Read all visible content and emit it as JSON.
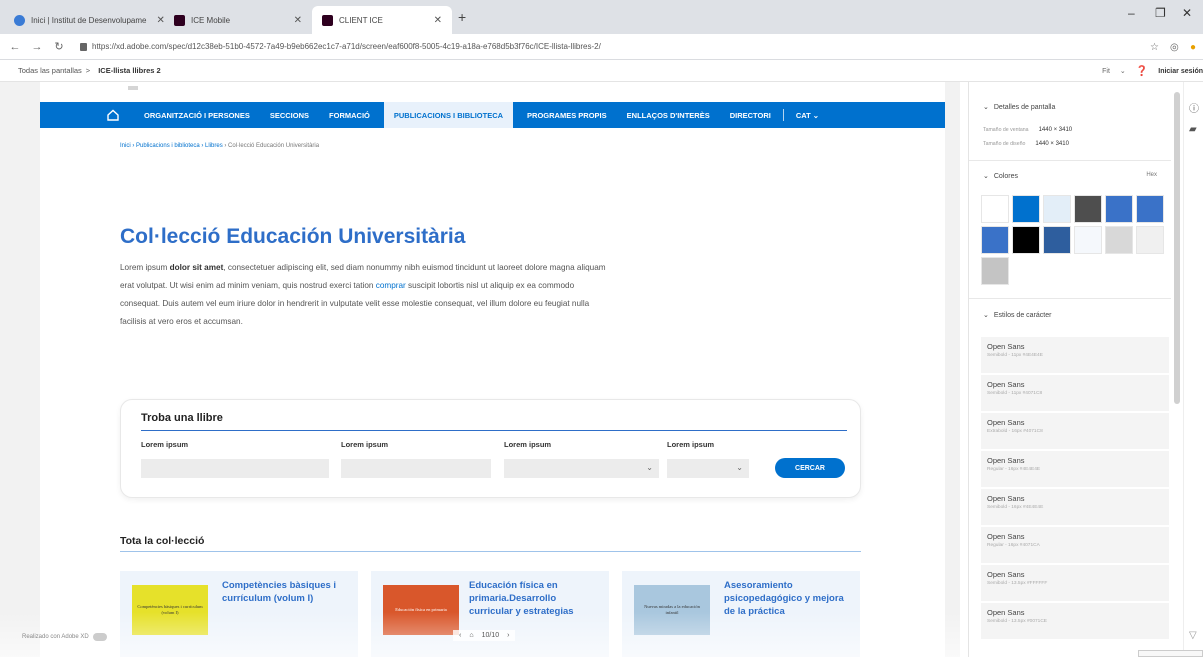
{
  "browser": {
    "tabs": [
      {
        "title": "Inici | Institut de Desenvolupame"
      },
      {
        "title": "ICE Mobile"
      },
      {
        "title": "CLIENT ICE"
      }
    ],
    "url": "https://xd.adobe.com/spec/d12c38eb-51b0-4572-7a49-b9eb662ec1c7-a71d/screen/eaf600f8-5005-4c19-a18a-e768d5b3f76c/ICE-llista-llibres-2/"
  },
  "xd": {
    "breadcrumb_root": "Todas las pantallas",
    "breadcrumb_sep": ">",
    "breadcrumb_current": "ICE-llista llibres 2",
    "zoom": "Fit",
    "signin": "Iniciar sesión",
    "made_with": "Realizado con Adobe XD",
    "pager": "10/10"
  },
  "site": {
    "menu": [
      "ORGANITZACIÓ I PERSONES",
      "SECCIONS",
      "FORMACIÓ",
      "PUBLICACIONS I BIBLIOTECA",
      "PROGRAMES PROPIS",
      "ENLLAÇOS D'INTERÈS",
      "DIRECTORI"
    ],
    "lang": "CAT",
    "crumb_link": "Inici › Publicacions i biblioteca › Llibres",
    "crumb_current": " › Col·lecció Educación Universitària",
    "title": "Col·lecció Educación Universitària",
    "para_a": "Lorem ipsum ",
    "para_b": "dolor sit amet",
    "para_c": ", consectetuer adipiscing elit, sed diam nonummy nibh euismod tincidunt ut laoreet dolore magna aliquam erat volutpat. Ut wisi enim ad minim veniam, quis nostrud exerci tation ",
    "para_link": "comprar",
    "para_d": " suscipit lobortis nisl ut aliquip ex ea commodo consequat. Duis autem vel eum iriure dolor in hendrerit in vulputate velit esse molestie consequat, vel illum dolore eu feugiat nulla facilisis at vero eros et accumsan.",
    "search_title": "Troba una llibre",
    "field_labels": [
      "Lorem ipsum",
      "Lorem ipsum",
      "Lorem ipsum",
      "Lorem ipsum"
    ],
    "search_button": "CERCAR",
    "collection_title": "Tota la col·lecció",
    "cards": [
      {
        "title": "Competències bàsiques i currículum (volum I)",
        "cover_text": "Competències bàsiques i currículum (volum I)",
        "cover_color": "#e6e12a"
      },
      {
        "title": "Educación física en primaria.Desarrollo curricular y estrategias",
        "cover_text": "Educación física en primaria",
        "cover_color": "#d9572b"
      },
      {
        "title": "Asesoramiento psicopedagógico y mejora de la práctica",
        "cover_text": "Nuevas miradas a la educación infantil",
        "cover_color": "#a9c7de"
      }
    ]
  },
  "panel": {
    "screen_details": "Detalles de pantalla",
    "window_size_label": "Tamaño de ventana",
    "window_size": "1440 × 3410",
    "design_size_label": "Tamaño de diseño",
    "design_size": "1440 × 3410",
    "colors_title": "Colores",
    "hex_label": "Hex",
    "colors": [
      "#FFFFFF",
      "#0071CE",
      "#E3EEF8",
      "#4E4E4E",
      "#3A72C8",
      "#3A72C8",
      "#3A72C8",
      "#000000",
      "#2E5E9E",
      "#F5F8FC",
      "#D8D8D8",
      "#F0F0F0",
      "#C4C4C4"
    ],
    "char_styles_title": "Estilos de carácter",
    "char_styles": [
      {
        "name": "Open Sans",
        "desc": "Semibold - 11px #4E4E4E"
      },
      {
        "name": "Open Sans",
        "desc": "Semibold - 11px #4071C8"
      },
      {
        "name": "Open Sans",
        "desc": "Extrabold - 16px #4071C8"
      },
      {
        "name": "Open Sans",
        "desc": "Regular - 16px #4E4E4E"
      },
      {
        "name": "Open Sans",
        "desc": "Semibold - 16px #4E4E4E"
      },
      {
        "name": "Open Sans",
        "desc": "Regular - 16px #4071CA"
      },
      {
        "name": "Open Sans",
        "desc": "Semibold - 13.5px #FFFFFF"
      },
      {
        "name": "Open Sans",
        "desc": "Semibold - 13.5px #0071CE"
      }
    ]
  }
}
